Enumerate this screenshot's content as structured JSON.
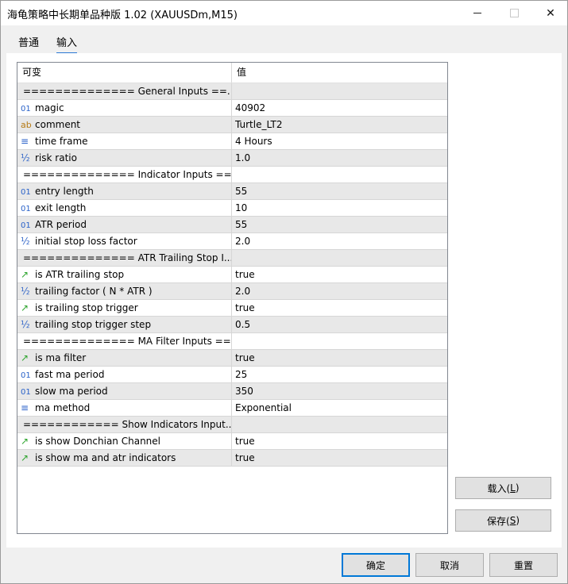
{
  "window": {
    "title": "海龟策略中长期单品种版 1.02 (XAUUSDm,M15)",
    "minimize_glyph": "—",
    "maximize_glyph": "☐",
    "close_glyph": "✕"
  },
  "tabs": [
    {
      "label": "普通",
      "active": false
    },
    {
      "label": "输入",
      "active": true
    }
  ],
  "grid": {
    "headers": {
      "name": "可变",
      "value": "值"
    },
    "rows": [
      {
        "type": "separator",
        "name": "============== General Inputs ==...",
        "value": ""
      },
      {
        "type": "param",
        "icon": "int-icon",
        "glyph": "01",
        "name": "magic",
        "value": "40902"
      },
      {
        "type": "param",
        "icon": "string-icon",
        "glyph": "ab",
        "name": "comment",
        "value": "Turtle_LT2"
      },
      {
        "type": "param",
        "icon": "enum-icon",
        "glyph": "≡",
        "name": "time frame",
        "value": "4 Hours"
      },
      {
        "type": "param",
        "icon": "double-icon",
        "glyph": "½",
        "name": "risk ratio",
        "value": "1.0"
      },
      {
        "type": "separator",
        "name": "============== Indicator Inputs ==...",
        "value": ""
      },
      {
        "type": "param",
        "icon": "int-icon",
        "glyph": "01",
        "name": "entry length",
        "value": "55"
      },
      {
        "type": "param",
        "icon": "int-icon",
        "glyph": "01",
        "name": "exit length",
        "value": "10"
      },
      {
        "type": "param",
        "icon": "int-icon",
        "glyph": "01",
        "name": "ATR period",
        "value": "55"
      },
      {
        "type": "param",
        "icon": "double-icon",
        "glyph": "½",
        "name": "initial stop loss factor",
        "value": "2.0"
      },
      {
        "type": "separator",
        "name": "============== ATR Trailing Stop I...",
        "value": ""
      },
      {
        "type": "param",
        "icon": "bool-icon",
        "glyph": "↗",
        "name": "is ATR trailing stop",
        "value": "true"
      },
      {
        "type": "param",
        "icon": "double-icon",
        "glyph": "½",
        "name": "trailing factor ( N * ATR )",
        "value": "2.0"
      },
      {
        "type": "param",
        "icon": "bool-icon",
        "glyph": "↗",
        "name": "is trailing stop trigger",
        "value": "true"
      },
      {
        "type": "param",
        "icon": "double-icon",
        "glyph": "½",
        "name": "trailing stop trigger step",
        "value": "0.5"
      },
      {
        "type": "separator",
        "name": "============== MA Filter Inputs ==...",
        "value": ""
      },
      {
        "type": "param",
        "icon": "bool-icon",
        "glyph": "↗",
        "name": "is ma filter",
        "value": "true"
      },
      {
        "type": "param",
        "icon": "int-icon",
        "glyph": "01",
        "name": "fast  ma period",
        "value": "25"
      },
      {
        "type": "param",
        "icon": "int-icon",
        "glyph": "01",
        "name": "slow  ma period",
        "value": "350"
      },
      {
        "type": "param",
        "icon": "enum-icon",
        "glyph": "≡",
        "name": "ma method",
        "value": "Exponential"
      },
      {
        "type": "separator",
        "name": "============ Show Indicators Input...",
        "value": ""
      },
      {
        "type": "param",
        "icon": "bool-icon",
        "glyph": "↗",
        "name": "is show Donchian Channel",
        "value": "true"
      },
      {
        "type": "param",
        "icon": "bool-icon",
        "glyph": "↗",
        "name": "is show ma and atr indicators",
        "value": "true"
      }
    ]
  },
  "buttons": {
    "load": {
      "text": "载入(",
      "key": "L",
      "end": ")"
    },
    "save": {
      "text": "保存(",
      "key": "S",
      "end": ")"
    },
    "ok": "确定",
    "cancel": "取消",
    "reset": "重置"
  },
  "colors": {
    "accent": "#0078d7",
    "tab_underline": "#2a78d4",
    "row_alt": "#e8e8e8",
    "bool_icon": "#2ea52e",
    "int_icon": "#2a62c9",
    "string_icon": "#b67b16"
  }
}
